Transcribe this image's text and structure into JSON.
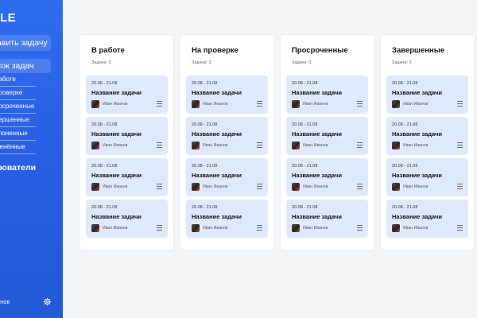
{
  "sidebar": {
    "logo": "LE",
    "add_task_label": "авить задачу",
    "task_list_label": "сок задач",
    "sub_items": [
      "работе",
      "проверке",
      "росроченные",
      "вершенные",
      "клоненные",
      "менённые"
    ],
    "users_label": "ьзователи",
    "user_name": "ванов",
    "settings_icon": "gear-icon"
  },
  "columns": [
    {
      "title": "В работе",
      "count_label": "Задачи: 3",
      "cards": [
        {
          "date": "20.08 - 21.08",
          "title": "Название задачи",
          "assignee": "Иван Иванов"
        },
        {
          "date": "20.08 - 21.08",
          "title": "Название задачи",
          "assignee": "Иван Иванов"
        },
        {
          "date": "20.08 - 21.08",
          "title": "Название задачи",
          "assignee": "Иван Иванов"
        },
        {
          "date": "20.08 - 21.08",
          "title": "Название задачи",
          "assignee": "Иван Иванов"
        }
      ]
    },
    {
      "title": "На проверке",
      "count_label": "Задачи: 3",
      "cards": [
        {
          "date": "20.08 - 21.08",
          "title": "Название задачи",
          "assignee": "Иван Иванов"
        },
        {
          "date": "20.08 - 21.08",
          "title": "Название задачи",
          "assignee": "Иван Иванов"
        },
        {
          "date": "20.08 - 21.08",
          "title": "Название задачи",
          "assignee": "Иван Иванов"
        },
        {
          "date": "20.08 - 21.08",
          "title": "Название задачи",
          "assignee": "Иван Иванов"
        }
      ]
    },
    {
      "title": "Просроченные",
      "count_label": "Задачи: 3",
      "cards": [
        {
          "date": "20.08 - 21.08",
          "title": "Название задачи",
          "assignee": "Иван Иванов"
        },
        {
          "date": "20.08 - 21.08",
          "title": "Название задачи",
          "assignee": "Иван Иванов"
        },
        {
          "date": "20.08 - 21.08",
          "title": "Название задачи",
          "assignee": "Иван Иванов"
        },
        {
          "date": "20.08 - 21.08",
          "title": "Название задачи",
          "assignee": "Иван Иванов"
        }
      ]
    },
    {
      "title": "Завершенные",
      "count_label": "Задачи: 3",
      "cards": [
        {
          "date": "20.08 - 21.08",
          "title": "Название задачи",
          "assignee": "Иван Иванов"
        },
        {
          "date": "20.08 - 21.08",
          "title": "Название задачи",
          "assignee": "Иван Иванов"
        },
        {
          "date": "20.08 - 21.08",
          "title": "Название задачи",
          "assignee": "Иван Иванов"
        },
        {
          "date": "20.08 - 21.08",
          "title": "Название задачи",
          "assignee": "Иван Иванов"
        }
      ]
    }
  ],
  "colors": {
    "sidebar": "#2a61e6",
    "card": "#dfe9fc",
    "background": "#f3f4f6"
  }
}
